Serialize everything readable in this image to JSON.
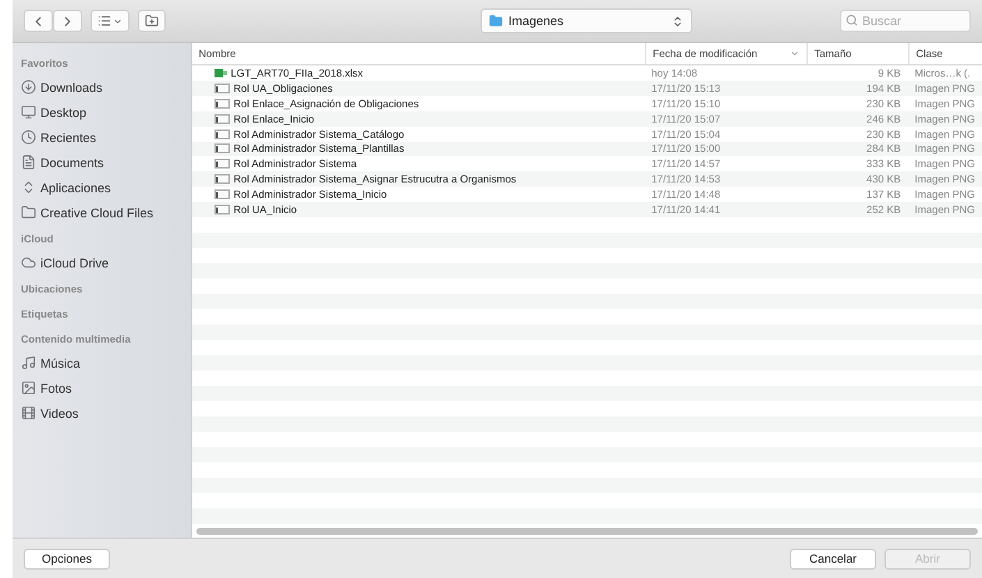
{
  "toolbar": {
    "location": "Imagenes",
    "search": {
      "placeholder": "Buscar"
    }
  },
  "sidebar": {
    "sections": [
      {
        "title": "Favoritos",
        "items": [
          "Downloads",
          "Desktop",
          "Recientes",
          "Documents",
          "Aplicaciones",
          "Creative Cloud Files"
        ]
      },
      {
        "title": "iCloud",
        "items": [
          "iCloud Drive"
        ]
      },
      {
        "title": "Ubicaciones"
      },
      {
        "title": "Etiquetas"
      },
      {
        "title": "Contenido multimedia",
        "items": [
          "Música",
          "Fotos",
          "Videos"
        ]
      }
    ]
  },
  "table": {
    "columns": [
      "Nombre",
      "Fecha de modificación",
      "Tamaño",
      "Clase"
    ],
    "rows": [
      {
        "kind": "spreadsheet",
        "name": "LGT_ART70_FIIa_2018.xlsx",
        "date": "hoy 14:08",
        "size": "9 KB",
        "type": "Micros…k (."
      },
      {
        "kind": "image",
        "name": "Rol UA_Obligaciones",
        "date": "17/11/20 15:13",
        "size": "194 KB",
        "type": "Imagen PNG"
      },
      {
        "kind": "image",
        "name": "Rol Enlace_Asignación de Obligaciones",
        "date": "17/11/20 15:10",
        "size": "230 KB",
        "type": "Imagen PNG"
      },
      {
        "kind": "image",
        "name": "Rol Enlace_Inicio",
        "date": "17/11/20 15:07",
        "size": "246 KB",
        "type": "Imagen PNG"
      },
      {
        "kind": "image",
        "name": "Rol Administrador Sistema_Catálogo",
        "date": "17/11/20 15:04",
        "size": "230 KB",
        "type": "Imagen PNG"
      },
      {
        "kind": "image",
        "name": "Rol Administrador Sistema_Plantillas",
        "date": "17/11/20 15:00",
        "size": "284 KB",
        "type": "Imagen PNG"
      },
      {
        "kind": "image",
        "name": "Rol Administrador Sistema",
        "date": "17/11/20 14:57",
        "size": "333 KB",
        "type": "Imagen PNG"
      },
      {
        "kind": "image",
        "name": "Rol Administrador Sistema_Asignar Estrucutra a Organismos",
        "date": "17/11/20 14:53",
        "size": "430 KB",
        "type": "Imagen PNG"
      },
      {
        "kind": "image",
        "name": "Rol Administrador Sistema_Inicio",
        "date": "17/11/20 14:48",
        "size": "137 KB",
        "type": "Imagen PNG"
      },
      {
        "kind": "image",
        "name": "Rol UA_Inicio",
        "date": "17/11/20 14:41",
        "size": "252 KB",
        "type": "Imagen PNG"
      }
    ]
  },
  "footer": {
    "options": "Opciones",
    "buttons": [
      {
        "label": "Cancelar",
        "disabled": false
      },
      {
        "label": "Abrir",
        "disabled": true
      }
    ]
  }
}
